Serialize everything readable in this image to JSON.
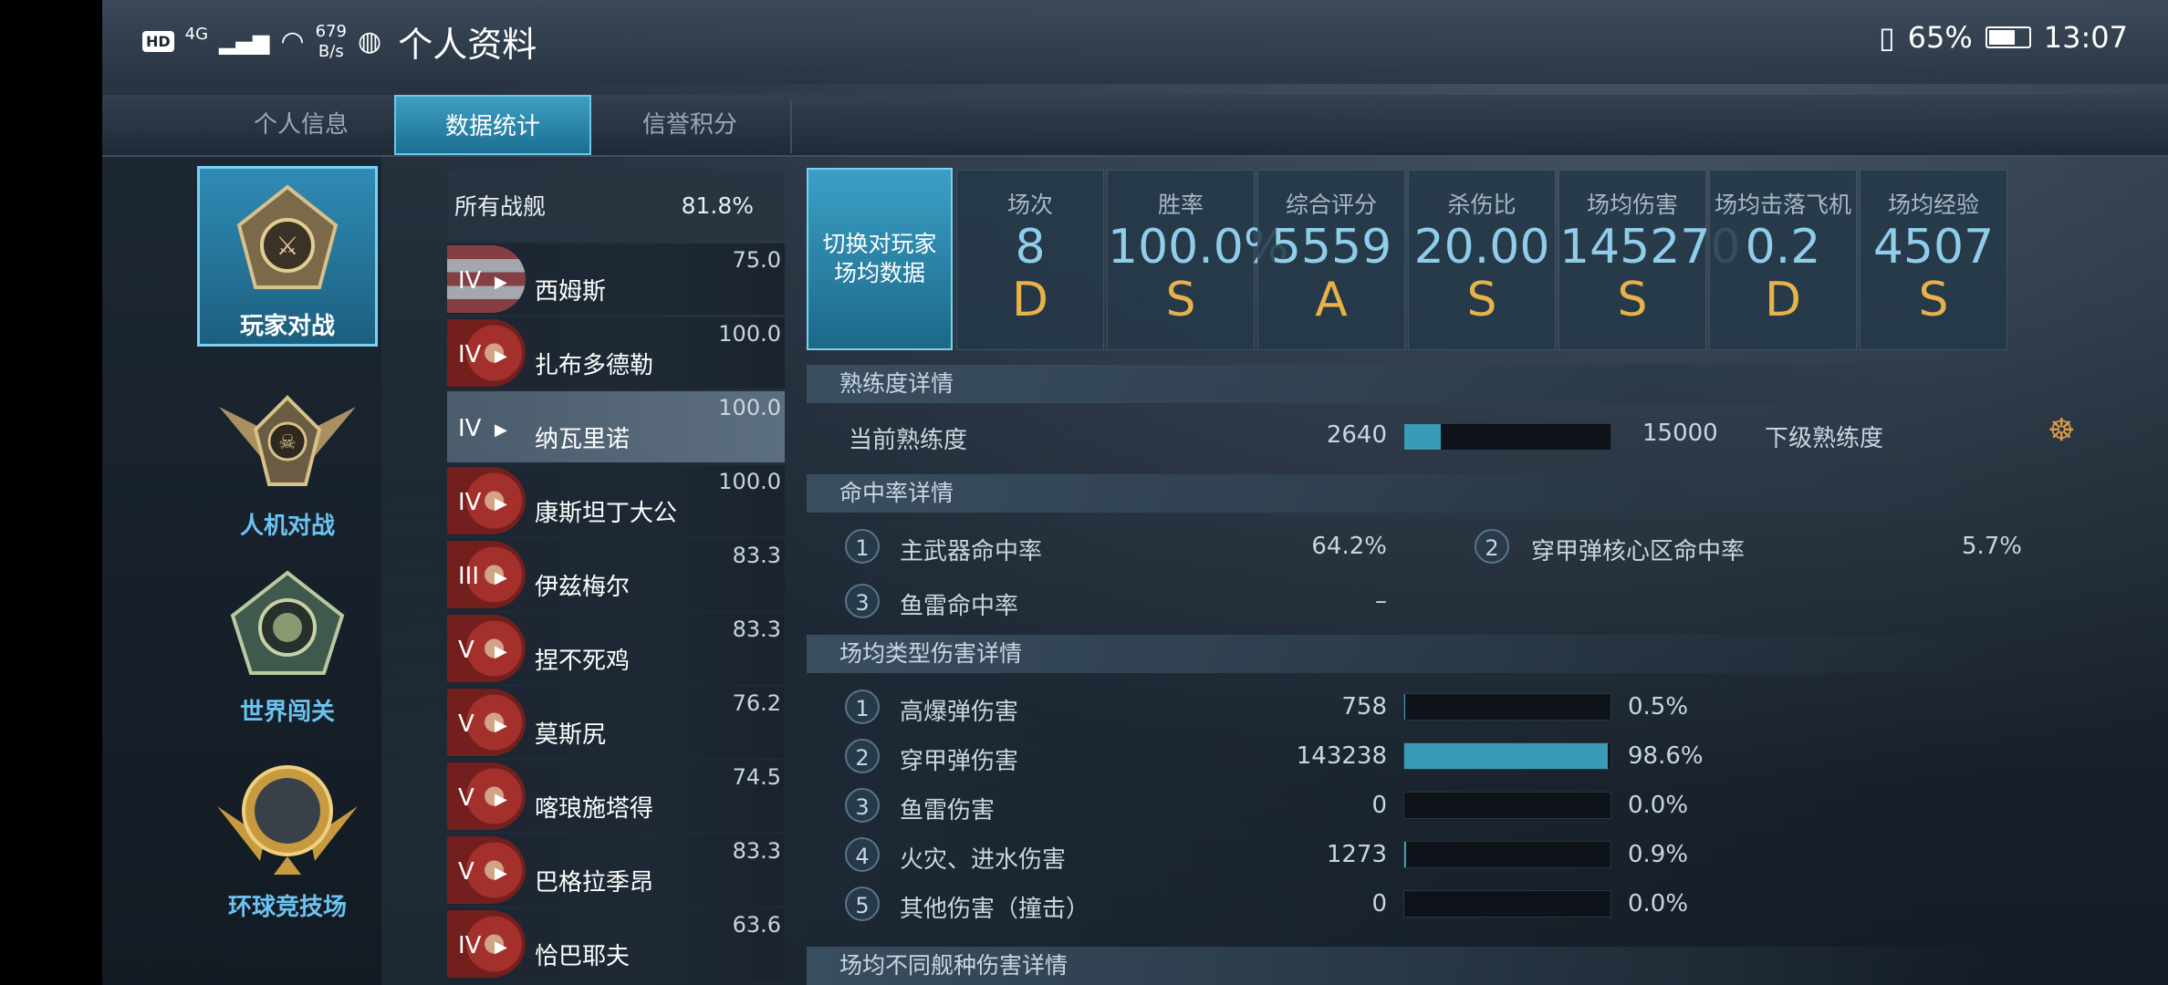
{
  "status_bar": {
    "network_tag": "HD",
    "signal": "4G",
    "speed_value": "679",
    "speed_unit": "B/s",
    "app_title": "个人资料",
    "battery": "65%",
    "time": "13:07"
  },
  "tabs": [
    {
      "label": "个人信息",
      "active": false
    },
    {
      "label": "数据统计",
      "active": true
    },
    {
      "label": "信誉积分",
      "active": false
    }
  ],
  "modes": [
    {
      "label": "玩家对战",
      "active": true
    },
    {
      "label": "人机对战",
      "active": false
    },
    {
      "label": "世界闯关",
      "active": false
    },
    {
      "label": "环球竞技场",
      "active": false
    }
  ],
  "all_ships": {
    "label": "所有战舰",
    "value": "81.8%"
  },
  "ships": [
    {
      "tier": "IV",
      "name": "西姆斯",
      "score": "75.0",
      "flag": "us",
      "selected": false
    },
    {
      "tier": "IV",
      "name": "扎布多德勒",
      "score": "100.0",
      "flag": "cn",
      "selected": false
    },
    {
      "tier": "IV",
      "name": "纳瓦里诺",
      "score": "100.0",
      "flag": "none",
      "selected": true
    },
    {
      "tier": "IV",
      "name": "康斯坦丁大公",
      "score": "100.0",
      "flag": "cn",
      "selected": false
    },
    {
      "tier": "III",
      "name": "伊兹梅尔",
      "score": "83.3",
      "flag": "cn",
      "selected": false
    },
    {
      "tier": "V",
      "name": "捏不死鸡",
      "score": "83.3",
      "flag": "cn",
      "selected": false
    },
    {
      "tier": "V",
      "name": "莫斯尻",
      "score": "76.2",
      "flag": "cn",
      "selected": false
    },
    {
      "tier": "V",
      "name": "喀琅施塔得",
      "score": "74.5",
      "flag": "cn",
      "selected": false
    },
    {
      "tier": "V",
      "name": "巴格拉季昂",
      "score": "83.3",
      "flag": "cn",
      "selected": false
    },
    {
      "tier": "IV",
      "name": "恰巴耶夫",
      "score": "63.6",
      "flag": "cn",
      "selected": false
    }
  ],
  "switch_button": "切换对玩家场均数据",
  "stats": [
    {
      "label": "场次",
      "value": "8",
      "grade": "D"
    },
    {
      "label": "胜率",
      "value": "100.0%",
      "grade": "S"
    },
    {
      "label": "综合评分",
      "value": "5559",
      "grade": "A"
    },
    {
      "label": "杀伤比",
      "value": "20.00",
      "grade": "S"
    },
    {
      "label": "场均伤害",
      "value": "145270",
      "grade": "S"
    },
    {
      "label": "场均击落飞机",
      "value": "0.2",
      "grade": "D"
    },
    {
      "label": "场均经验",
      "value": "4507",
      "grade": "S"
    }
  ],
  "proficiency": {
    "section_title": "熟练度详情",
    "current_label": "当前熟练度",
    "current_value": "2640",
    "max_value": "15000",
    "next_label": "下级熟练度",
    "fill_fraction": 0.176
  },
  "hit_rate": {
    "section_title": "命中率详情",
    "items": [
      {
        "index": "1",
        "label": "主武器命中率",
        "value": "64.2%"
      },
      {
        "index": "2",
        "label": "穿甲弹核心区命中率",
        "value": "5.7%"
      },
      {
        "index": "3",
        "label": "鱼雷命中率",
        "value": "–"
      }
    ]
  },
  "damage_types": {
    "section_title": "场均类型伤害详情",
    "items": [
      {
        "index": "1",
        "label": "高爆弹伤害",
        "value": "758",
        "percent": "0.5%",
        "fill_fraction": 0.005
      },
      {
        "index": "2",
        "label": "穿甲弹伤害",
        "value": "143238",
        "percent": "98.6%",
        "fill_fraction": 0.986
      },
      {
        "index": "3",
        "label": "鱼雷伤害",
        "value": "0",
        "percent": "0.0%",
        "fill_fraction": 0.0
      },
      {
        "index": "4",
        "label": "火灾、进水伤害",
        "value": "1273",
        "percent": "0.9%",
        "fill_fraction": 0.009
      },
      {
        "index": "5",
        "label": "其他伤害（撞击）",
        "value": "0",
        "percent": "0.0%",
        "fill_fraction": 0.0
      }
    ]
  },
  "ship_class_damage": {
    "section_title": "场均不同舰种伤害详情"
  }
}
